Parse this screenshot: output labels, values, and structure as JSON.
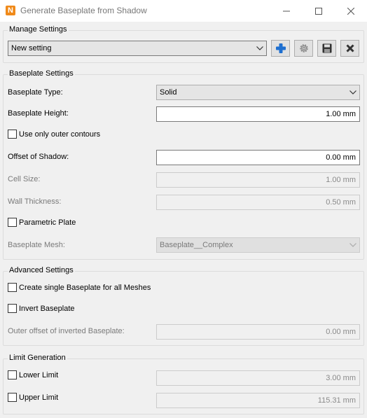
{
  "window": {
    "title": "Generate Baseplate from Shadow",
    "icon_letter": "N",
    "controls": [
      "minimize-icon",
      "maximize-icon",
      "close-icon"
    ]
  },
  "manage_settings": {
    "title": "Manage Settings",
    "selected_setting": "New setting",
    "buttons": [
      "add-icon",
      "gear-icon",
      "save-icon",
      "delete-icon"
    ],
    "colors": {
      "add": "#1e6fd0",
      "delete": "#333333"
    }
  },
  "baseplate_settings": {
    "title": "Baseplate Settings",
    "type_label": "Baseplate Type:",
    "type_value": "Solid",
    "height_label": "Baseplate Height:",
    "height_value": "1.00 mm",
    "outer_contours_label": "Use only outer contours",
    "outer_contours_checked": false,
    "offset_label": "Offset of Shadow:",
    "offset_value": "0.00 mm",
    "cell_size_label": "Cell Size:",
    "cell_size_value": "1.00 mm",
    "wall_thickness_label": "Wall Thickness:",
    "wall_thickness_value": "0.50 mm",
    "parametric_label": "Parametric Plate",
    "parametric_checked": false,
    "mesh_label": "Baseplate Mesh:",
    "mesh_value": "Baseplate__Complex"
  },
  "advanced_settings": {
    "title": "Advanced Settings",
    "single_label": "Create single Baseplate for all Meshes",
    "single_checked": false,
    "invert_label": "Invert Baseplate",
    "invert_checked": false,
    "outer_offset_label": "Outer offset of inverted Baseplate:",
    "outer_offset_value": "0.00 mm"
  },
  "limit_generation": {
    "title": "Limit Generation",
    "lower_label": "Lower Limit",
    "lower_checked": false,
    "lower_value": "3.00 mm",
    "upper_label": "Upper Limit",
    "upper_checked": false,
    "upper_value": "115.31 mm"
  }
}
